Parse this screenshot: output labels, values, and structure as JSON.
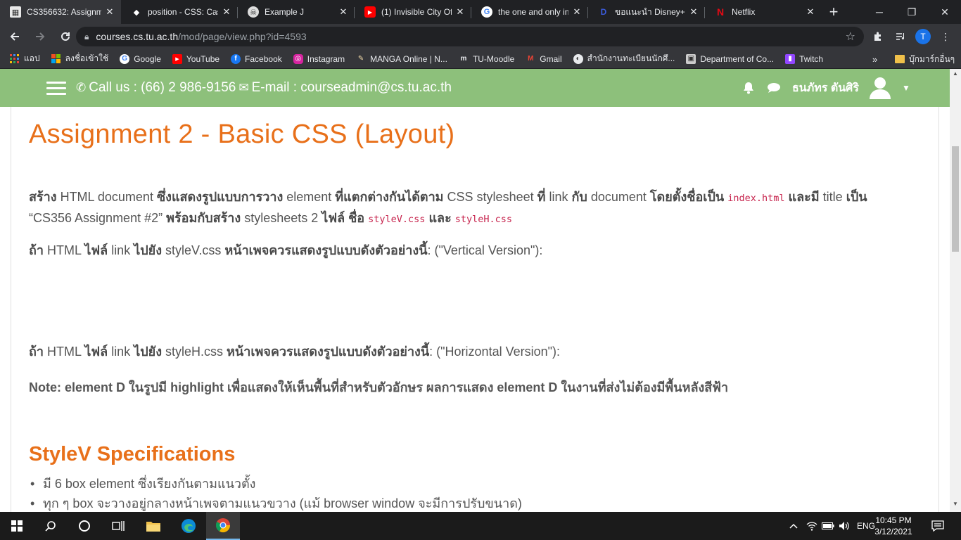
{
  "tabs": [
    {
      "title": "CS356632: Assignme",
      "icon": "moodle-icon",
      "active": true
    },
    {
      "title": "position - CSS: Cas",
      "icon": "mdn-icon"
    },
    {
      "title": "Example J",
      "icon": "skull-icon"
    },
    {
      "title": "(1) Invisible City Of",
      "icon": "youtube-icon"
    },
    {
      "title": "the one and only in",
      "icon": "google-icon"
    },
    {
      "title": "ขอแนะนำ Disney+",
      "icon": "disney-icon"
    },
    {
      "title": "Netflix",
      "icon": "netflix-icon"
    }
  ],
  "address": {
    "host": "courses.cs.tu.ac.th",
    "path": "/mod/page/view.php?id=4593"
  },
  "profile_initial": "T",
  "bookmarks": [
    {
      "label": "แอป",
      "icon": "apps-icon"
    },
    {
      "label": "ลงชื่อเข้าใช้",
      "icon": "microsoft-icon"
    },
    {
      "label": "Google",
      "icon": "google-icon"
    },
    {
      "label": "YouTube",
      "icon": "youtube-icon"
    },
    {
      "label": "Facebook",
      "icon": "facebook-icon"
    },
    {
      "label": "Instagram",
      "icon": "instagram-icon"
    },
    {
      "label": "MANGA Online | N...",
      "icon": "manga-icon"
    },
    {
      "label": "TU-Moodle",
      "icon": "moodle-icon"
    },
    {
      "label": "Gmail",
      "icon": "gmail-icon"
    },
    {
      "label": "สำนักงานทะเบียนนักศึ...",
      "icon": "registrar-icon"
    },
    {
      "label": "Department of Co...",
      "icon": "department-icon"
    },
    {
      "label": "Twitch",
      "icon": "twitch-icon"
    }
  ],
  "bookmarks_more": "»",
  "bookmarks_other": "บุ๊กมาร์กอื่นๆ",
  "navbar": {
    "call_label": "Call us : (66) 2 986-9156",
    "email_label": "E-mail : courseadmin@cs.tu.ac.th",
    "user_name": "ธนภัทร ตันศิริ"
  },
  "page": {
    "title": "Assignment 2 - Basic CSS (Layout)",
    "p1_a": "สร้าง",
    "p1_b": " HTML document ",
    "p1_c": "ซึ่งแสดงรูปแบบการวาง",
    "p1_d": " element ",
    "p1_e": "ที่แตกต่างกันได้ตาม",
    "p1_f": " CSS stylesheet ",
    "p1_g": "ที่",
    "p1_h": " link ",
    "p1_i": "กับ",
    "p1_j": " document ",
    "p1_k": "โดยตั้งชื่อเป็น",
    "p1_code1": "index.html",
    "p1_l": "และมี",
    "p1_m": " title ",
    "p1_n": "เป็น",
    "p1_o": "“CS356 Assignment #2” ",
    "p1_p": "พร้อมกับสร้าง",
    "p1_q": "  stylesheets 2 ",
    "p1_r": "ไฟล์ ชื่อ",
    "p1_code2": "styleV.css",
    "p1_s": "และ",
    "p1_code3": "styleH.css",
    "p2_a": "ถ้า",
    "p2_b": " HTML ",
    "p2_c": "ไฟล์",
    "p2_d": " link ",
    "p2_e": "ไปยัง",
    "p2_f": " styleV.css  ",
    "p2_g": "หน้าเพจควรแสดงรูปแบบดังตัวอย่างนี้",
    "p2_h": ": (\"Vertical  Version\"):",
    "p3_a": "ถ้า",
    "p3_b": " HTML ",
    "p3_c": "ไฟล์",
    "p3_d": " link ",
    "p3_e": "ไปยัง",
    "p3_f": " styleH.css  ",
    "p3_g": "หน้าเพจควรแสดงรูปแบบดังตัวอย่างนี้",
    "p3_h": ": (\"Horizontal Version\"):",
    "note": "Note: element D ในรูปมี highlight เพื่อแสดงให้เห็นพื้นที่สำหรับตัวอักษร ผลการแสดง element D ในงานที่ส่งไม่ต้องมีพื้นหลังสีฟ้า",
    "section_title": "StyleV Specifications",
    "bullets": [
      "มี 6 box element ซึ่งเรียงกันตามแนวตั้ง",
      "ทุก ๆ box จะวางอยู่กลางหน้าเพจตามแนวขวาง (แม้ browser window จะมีการปรับขนาด)"
    ]
  },
  "taskbar": {
    "language": "ENG",
    "time": "10:45 PM",
    "date": "3/12/2021"
  },
  "colors": {
    "navbar_bg": "#8dc07b",
    "title_orange": "#e8701a",
    "code_pink": "#c7254e",
    "chrome_dark": "#202124",
    "chrome_toolbar": "#35363a"
  }
}
